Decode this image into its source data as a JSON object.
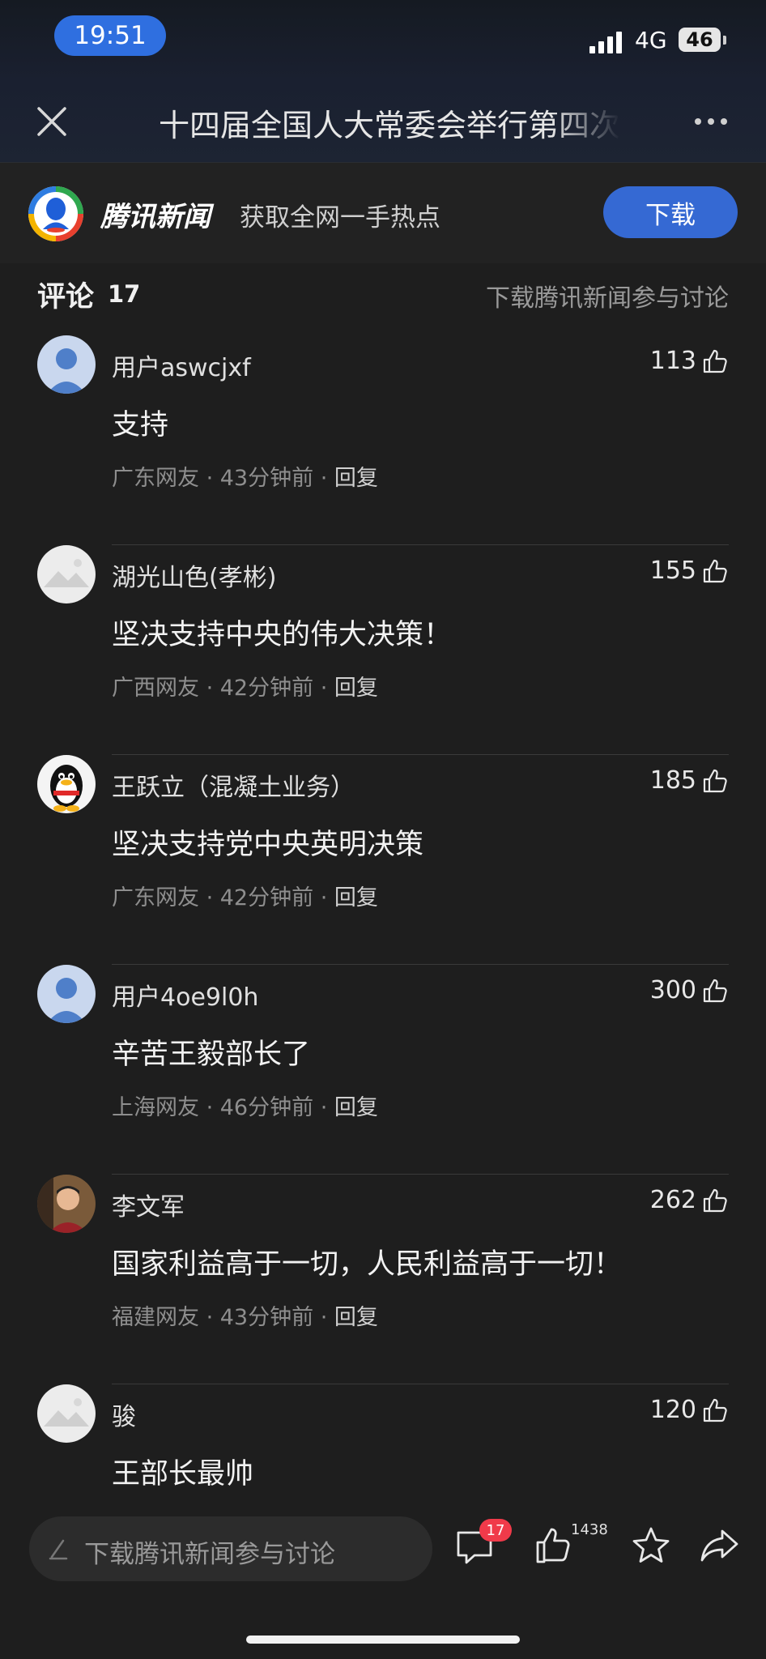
{
  "status": {
    "time": "19:51",
    "network": "4G",
    "battery": "46"
  },
  "titlebar": {
    "title": "十四届全国人大常委会举行第四次"
  },
  "banner": {
    "app_name": "腾讯新闻",
    "slogan": "获取全网一手热点",
    "download": "下载"
  },
  "comments_header": {
    "label": "评论",
    "count": "17",
    "link": "下载腾讯新闻参与讨论"
  },
  "comments": [
    {
      "user": "用户aswcjxf",
      "likes": "113",
      "text": "支持",
      "location": "广东网友",
      "time": "43分钟前",
      "reply": "回复",
      "avatar": "default-avatar-icon"
    },
    {
      "user": "湖光山色(孝彬)",
      "likes": "155",
      "text": "坚决支持中央的伟大决策！",
      "location": "广西网友",
      "time": "42分钟前",
      "reply": "回复",
      "avatar": "landscape-avatar"
    },
    {
      "user": "王跃立（混凝土业务）",
      "likes": "185",
      "text": "坚决支持党中央英明决策",
      "location": "广东网友",
      "time": "42分钟前",
      "reply": "回复",
      "avatar": "penguin-avatar"
    },
    {
      "user": "用户4oe9l0h",
      "likes": "300",
      "text": "辛苦王毅部长了",
      "location": "上海网友",
      "time": "46分钟前",
      "reply": "回复",
      "avatar": "default-avatar-icon"
    },
    {
      "user": "李文军",
      "likes": "262",
      "text": "国家利益高于一切，人民利益高于一切！",
      "location": "福建网友",
      "time": "43分钟前",
      "reply": "回复",
      "avatar": "photo-avatar"
    },
    {
      "user": "骏",
      "likes": "120",
      "text": "王部长最帅",
      "avatar": "landscape-avatar"
    }
  ],
  "bottombar": {
    "input_placeholder": "下载腾讯新闻参与讨论",
    "comment_badge": "17",
    "like_total": "1438"
  },
  "colors": {
    "accent": "#3569d3",
    "badge": "#f03a4a",
    "background": "#1e1e1e"
  }
}
